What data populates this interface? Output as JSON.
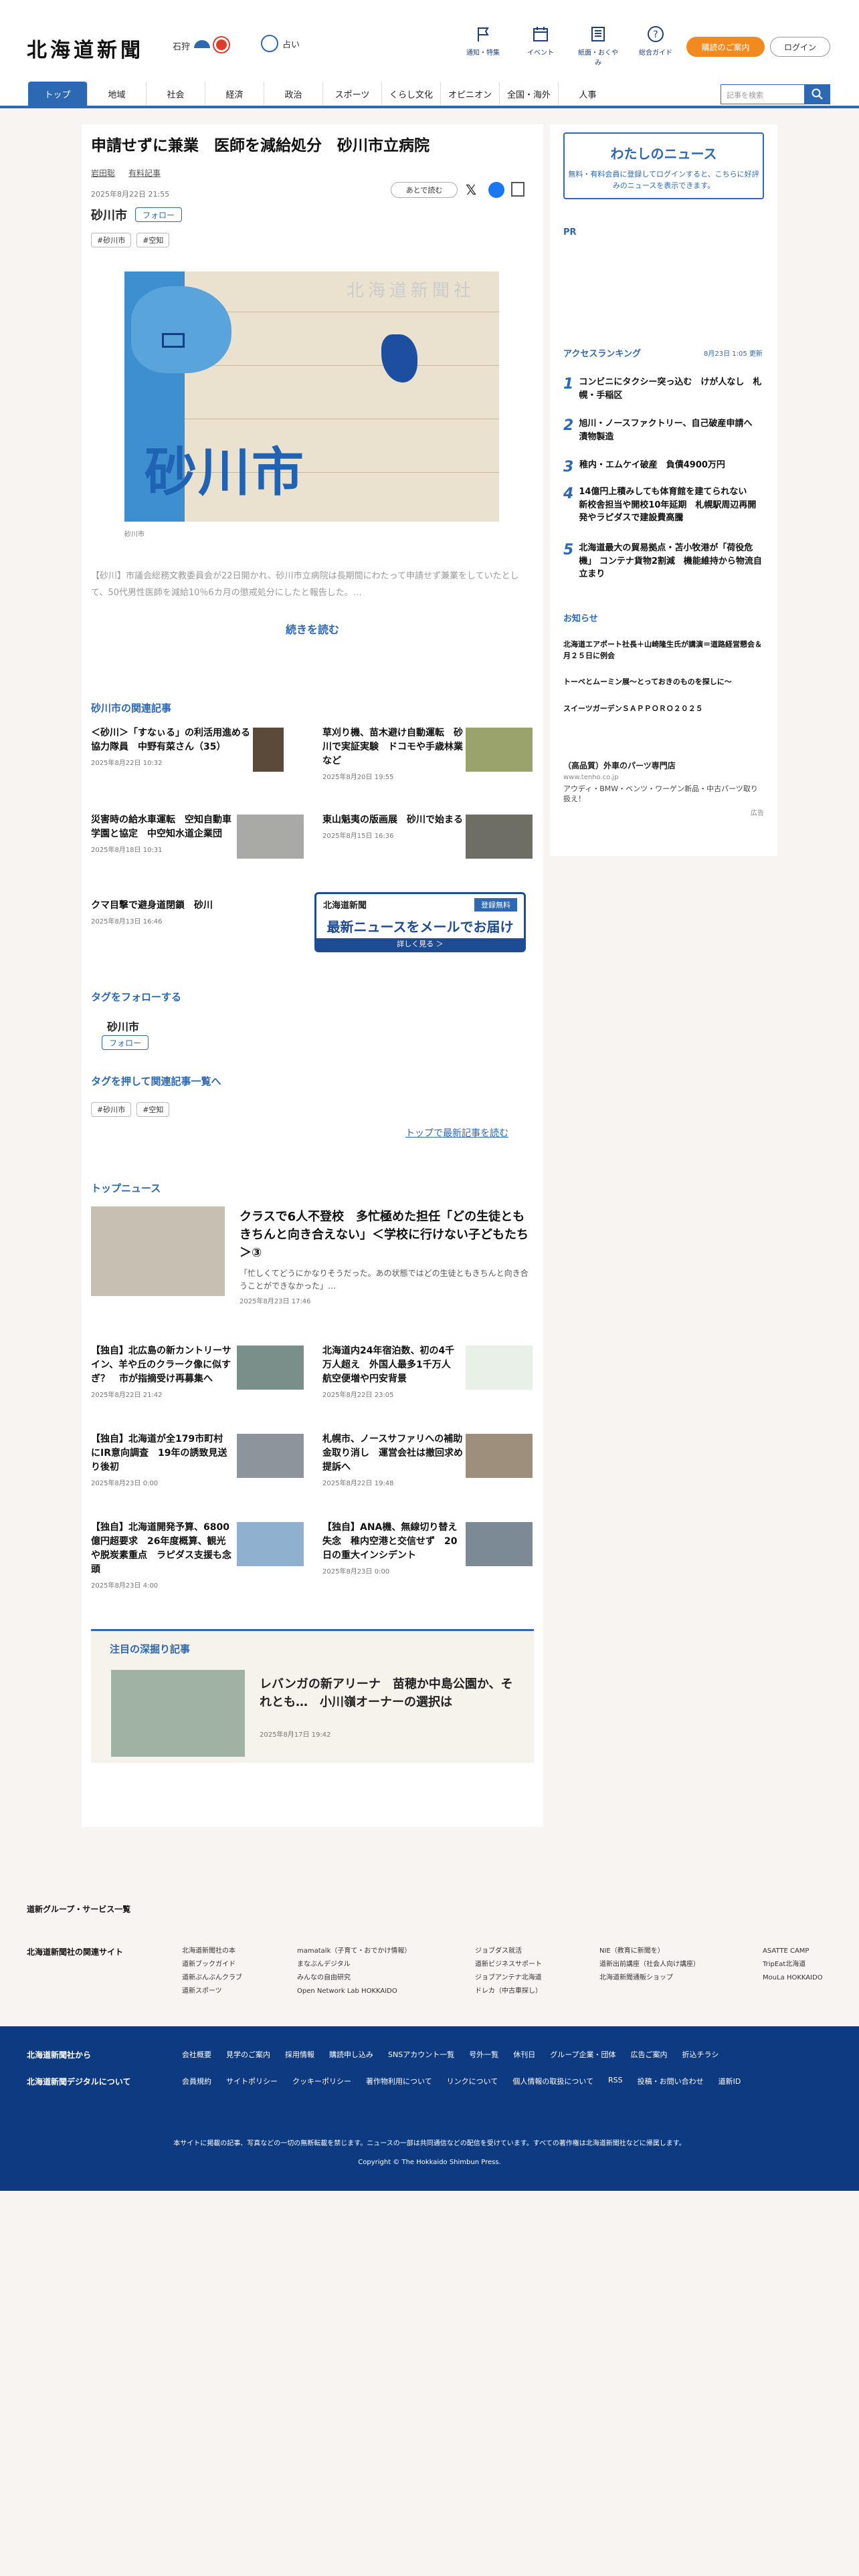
{
  "header": {
    "logo": "北海道新聞",
    "weather": {
      "location": "石狩",
      "tips_label": "占い"
    },
    "nav": [
      {
        "label": "通知・特集",
        "icon": "flag-icon"
      },
      {
        "label": "イベント",
        "icon": "calendar-icon"
      },
      {
        "label": "紙面・おくやみ",
        "icon": "newspaper-icon"
      },
      {
        "label": "総合ガイド",
        "icon": "question-icon"
      }
    ],
    "subscribe": "購読のご案内",
    "login": "ログイン"
  },
  "tabs": [
    "トップ",
    "地域",
    "社会",
    "経済",
    "政治",
    "スポーツ",
    "くらし文化",
    "オピニオン",
    "全国・海外",
    "人事"
  ],
  "search": {
    "placeholder": "記事を検索"
  },
  "article": {
    "title": "申請せずに兼業　医師を減給処分　砂川市立病院",
    "author": "岩田聡",
    "paid_label": "有料記事",
    "date": "2025年8月22日 21:55",
    "later": "あとで読む",
    "city": "砂川市",
    "follow": "フォロー",
    "tags": [
      "#砂川市",
      "#空知"
    ],
    "map_label": "砂川市",
    "map_watermark": "北海道新聞社",
    "caption": "砂川市",
    "lead": "【砂川】市議会総務文教委員会が22日開かれ、砂川市立病院は長期間にわたって申請せず兼業をしていたとして、50代男性医師を減給10％6カ月の懲戒処分にしたと報告した。…",
    "more": "続きを読む"
  },
  "related": {
    "heading": "砂川市の関連記事",
    "items": [
      {
        "title": "＜砂川＞「すなぃる」の利活用進める協力隊員　中野有菜さん（35）",
        "date": "2025年8月22日 10:32"
      },
      {
        "title": "草刈り機、苗木避け自動運転　砂川で実証実験　ドコモや手歳林業など",
        "date": "2025年8月20日 19:55"
      },
      {
        "title": "災害時の給水車運転　空知自動車学園と協定　中空知水道企業団",
        "date": "2025年8月18日 10:31"
      },
      {
        "title": "東山魁夷の版画展　砂川で始まる",
        "date": "2025年8月15日 16:36"
      },
      {
        "title": "クマ目撃で避身道閉鎖　砂川",
        "date": "2025年8月13日 16:46"
      }
    ]
  },
  "mail_banner": {
    "logo": "北海道新聞",
    "badge": "登録無料",
    "main": "最新ニュースをメールでお届け",
    "button": "詳しく見る ＞"
  },
  "follow_section": {
    "heading": "タグをフォローする",
    "city": "砂川市",
    "follow": "フォロー"
  },
  "tag_section": {
    "heading": "タグを押して関連記事一覧へ",
    "tags": [
      "#砂川市",
      "#空知"
    ],
    "top_link": "トップで最新記事を読む"
  },
  "top_news": {
    "heading": "トップニュース",
    "feature": {
      "title": "クラスで6人不登校　多忙極めた担任「どの生徒ともきちんと向き合えない」＜学校に行けない子どもたち＞③",
      "excerpt": "「忙しくてどうにかなりそうだった。あの状態ではどの生徒ともきちんと向き合うことができなかった」…",
      "date": "2025年8月23日 17:46"
    },
    "items": [
      {
        "title": "【独自】北広島の新カントリーサイン、羊や丘のクラーク像に似すぎ？　市が指摘受け再募集へ",
        "date": "2025年8月22日 21:42"
      },
      {
        "title": "北海道内24年宿泊数、初の4千万人超え　外国人最多1千万人　航空便増や円安背景",
        "date": "2025年8月22日 23:05"
      },
      {
        "title": "【独自】北海道が全179市町村にIR意向調査　19年の誘致見送り後初",
        "date": "2025年8月23日 0:00"
      },
      {
        "title": "札幌市、ノースサファリへの補助金取り消し　運営会社は撤回求め提訴へ",
        "date": "2025年8月22日 19:48"
      },
      {
        "title": "【独自】北海道開発予算、6800億円超要求　26年度概算、観光や脱炭素重点　ラピダス支援も念頭",
        "date": "2025年8月23日 4:00"
      },
      {
        "title": "【独自】ANA機、無線切り替え失念　稚内空港と交信せず　20日の重大インシデント",
        "date": "2025年8月23日 0:00"
      }
    ]
  },
  "deep": {
    "heading": "注目の深掘り記事",
    "title": "レバンガの新アリーナ　苗穂か中島公園か、それとも…　小川嶺オーナーの選択は",
    "date": "2025年8月17日 19:42"
  },
  "sidebar": {
    "mynews_title": "わたしのニュース",
    "mynews_desc": "無料・有料会員に登録してログインすると、こちらに好評みのニュースを表示できます。",
    "pr": "PR",
    "ranking_heading": "アクセスランキング",
    "ranking_date": "8月23日 1:05 更新",
    "ranking": [
      "コンビニにタクシー突っ込む　けが人なし　札幌・手稲区",
      "旭川・ノースファクトリー、自己破産申請へ　漬物製造",
      "稚内・エムケイ破産　負債4900万円",
      "14億円上積みしても体育館を建てられない　新校舎担当や開校10年延期　札幌駅周辺再開発やラピダスで建設費高騰",
      "北海道最大の貿易拠点・苫小牧港が「荷役危機」 コンテナ貨物2割減　機能維持から物流自立まり"
    ],
    "notice_heading": "お知らせ",
    "notices": [
      "北海道エアポート社長＋山崎隆生氏が講演＝道路経営懇会＆月２５日に例会",
      "トーベとムーミン展〜とっておきのものを探しに〜",
      "スイーツガーデンＳＡＰＰＯＲＯ２０２５"
    ],
    "ad": {
      "title": "（高品質）外車のパーツ専門店",
      "url": "www.tenho.co.jp",
      "text": "アウディ・BMW・ベンツ・ワーゲン新品・中古パーツ取り扱え！",
      "label": "広告"
    }
  },
  "footer": {
    "group_heading": "道新グループ・サービス一覧",
    "related_sites_heading": "北海道新聞社の関連サイト",
    "related_sites": [
      [
        "北海道新聞社の本",
        "道新ブックガイド",
        "道新ぶんぶんクラブ",
        "道新スポーツ"
      ],
      [
        "mamatalk（子育て・おでかけ情報）",
        "まなぶんデジタル",
        "みんなの自由研究",
        "Open Network Lab HOKKAIDO"
      ],
      [
        "ジョブダス就活",
        "道新ビジネスサポート",
        "ジョブアンテナ北海道",
        "ドレカ（中古車探し）"
      ],
      [
        "NIE（教育に新聞を）",
        "道新出前講座（社会人向け講座）",
        "北海道新聞通販ショップ"
      ],
      [
        "ASATTE CAMP",
        "TripEat北海道",
        "MouLa HOKKAIDO"
      ]
    ],
    "about_heading": "北海道新聞社から",
    "digital_heading": "北海道新聞デジタルについて",
    "about_links": [
      "会社概要",
      "見学のご案内",
      "採用情報",
      "購読申し込み",
      "SNSアカウント一覧",
      "号外一覧",
      "休刊日",
      "グループ企業・団体",
      "広告ご案内",
      "折込チラシ"
    ],
    "digital_links": [
      "会員規約",
      "サイトポリシー",
      "クッキーポリシー",
      "著作物利用について",
      "リンクについて",
      "個人情報の取扱について",
      "RSS",
      "投稿・お問い合わせ",
      "道新ID"
    ],
    "notice": "本サイトに掲載の記事、写真などの一切の無断転載を禁じます。ニュースの一部は共同通信などの配信を受けています。すべての著作権は北海道新聞社などに帰属します。",
    "copyright": "Copyright © The Hokkaido Shimbun Press."
  }
}
